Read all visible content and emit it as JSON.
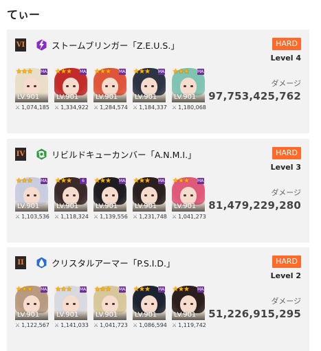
{
  "page": {
    "title": "てぃー"
  },
  "cards": [
    {
      "roman": "VI",
      "element": {
        "icon": "lightning-element-icon",
        "color": "#8a2bc9"
      },
      "boss_name": "ストームブリンガー「Z.E.U.S.」",
      "difficulty": "HARD",
      "level": "Level 4",
      "damage_label": "ダメージ",
      "damage": "97,753,425,762",
      "units": [
        {
          "level": "LV.901",
          "power": "1,074,185",
          "hair": "#e9dfc8",
          "tag": "MAX"
        },
        {
          "level": "LV.901",
          "power": "1,334,922",
          "hair": "#c32a2a",
          "tag": "MAX"
        },
        {
          "level": "LV.901",
          "power": "1,284,574",
          "hair": "#e0543a",
          "tag": "MAX"
        },
        {
          "level": "LV.901",
          "power": "1,184,337",
          "hair": "#2c3444",
          "tag": "MAX"
        },
        {
          "level": "LV.901",
          "power": "1,180,068",
          "hair": "#7fc3b3",
          "tag": "MAX"
        }
      ]
    },
    {
      "roman": "IV",
      "element": {
        "icon": "wind-element-icon",
        "color": "#2e9c3a"
      },
      "boss_name": "リビルドキューカンバー「A.N.M.I.」",
      "difficulty": "HARD",
      "level": "Level 3",
      "damage_label": "ダメージ",
      "damage": "81,479,229,280",
      "units": [
        {
          "level": "LV.901",
          "power": "1,103,536",
          "hair": "#c9cde0",
          "tag": "MAX"
        },
        {
          "level": "LV.901",
          "power": "1,118,324",
          "hair": "#3a2a2a",
          "tag": "6"
        },
        {
          "level": "LV.901",
          "power": "1,139,556",
          "hair": "#1e1e22",
          "tag": "MAX"
        },
        {
          "level": "LV.901",
          "power": "1,231,748",
          "hair": "#2a2020",
          "tag": "MAX"
        },
        {
          "level": "LV.901",
          "power": "1,041,273",
          "hair": "#e0587a",
          "tag": "MAX"
        }
      ]
    },
    {
      "roman": "II",
      "element": {
        "icon": "water-element-icon",
        "color": "#2a6fd8"
      },
      "boss_name": "クリスタルアーマー「P.S.I.D.」",
      "difficulty": "HARD",
      "level": "Level 2",
      "damage_label": "ダメージ",
      "damage": "51,226,915,295",
      "units": [
        {
          "level": "LV.901",
          "power": "1,122,567",
          "hair": "#b89a80",
          "tag": "MAX"
        },
        {
          "level": "LV.901",
          "power": "1,141,033",
          "hair": "#d8dae0",
          "tag": "MAX"
        },
        {
          "level": "LV.901",
          "power": "1,041,723",
          "hair": "#d8c79a",
          "tag": "MAX"
        },
        {
          "level": "LV.901",
          "power": "1,086,594",
          "hair": "#1c2330",
          "tag": "MAX"
        },
        {
          "level": "LV.901",
          "power": "1,119,742",
          "hair": "#2a1e1e",
          "tag": "MAX"
        }
      ]
    }
  ]
}
